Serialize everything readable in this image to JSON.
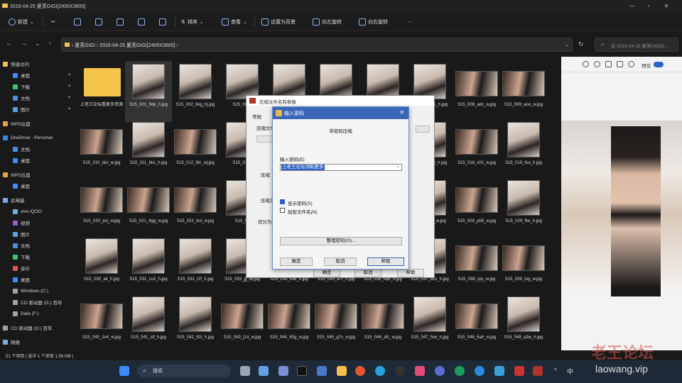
{
  "window": {
    "title": "2016-04-25 夏芙GIGI[2400X3600]"
  },
  "toolbar": {
    "new_label": "新建",
    "sort_label": "排序",
    "view_label": "查看",
    "set_wallpaper_label": "设置为背景",
    "rotate_right_label": "向左旋转",
    "rotate_left_label": "向右旋转",
    "more_label": "···"
  },
  "address": {
    "path_1": "夏芙GIGI",
    "path_2": "2016-04-25 夏芙GIGI[2400X3600]",
    "search_placeholder": "在 2016-04-25 夏芙GIGI[2..."
  },
  "sidebar": {
    "items": [
      {
        "label": "快速访问"
      },
      {
        "label": "桌面"
      },
      {
        "label": "下载"
      },
      {
        "label": "文档"
      },
      {
        "label": "图片"
      },
      {
        "label": "WPS云盘"
      },
      {
        "label": "OneDrive - Personal"
      },
      {
        "label": "文档"
      },
      {
        "label": "桌面"
      },
      {
        "label": "WPS云盘"
      },
      {
        "label": "桌面"
      },
      {
        "label": "此电脑"
      },
      {
        "label": "vivo iQOO"
      },
      {
        "label": "视频"
      },
      {
        "label": "图片"
      },
      {
        "label": "文档"
      },
      {
        "label": "下载"
      },
      {
        "label": "音乐"
      },
      {
        "label": "桌面"
      },
      {
        "label": "Windows (C:)"
      },
      {
        "label": "CD 驱动器 (G:) 百年"
      },
      {
        "label": "Data (F:)"
      },
      {
        "label": "CD 驱动器 (G:) 百年"
      },
      {
        "label": "网络"
      }
    ]
  },
  "files": [
    {
      "name": "上老王论坛看更多资源",
      "kind": "folder"
    },
    {
      "name": "S15_001_9dp_h.jpg"
    },
    {
      "name": "S15_002_6kg_hj.jpg"
    },
    {
      "name": "S15_003_"
    },
    {
      "name": ""
    },
    {
      "name": ""
    },
    {
      "name": ""
    },
    {
      "name": "S15_00_g1s_h.jpg"
    },
    {
      "name": "S15_008_adc_w.jpg",
      "wide": true
    },
    {
      "name": "S15_009_aoo_w.jpg",
      "wide": true
    },
    {
      "name": "S15_010_dur_w.jpg",
      "wide": true
    },
    {
      "name": "S15_011_bkc_h.jpg"
    },
    {
      "name": "S15_012_8lz_wj.jpg",
      "wide": true
    },
    {
      "name": "S15_013_"
    },
    {
      "name": ""
    },
    {
      "name": ""
    },
    {
      "name": ""
    },
    {
      "name": "S15_0_mx8_h.jpg"
    },
    {
      "name": "S15_018_x01_w.jpg",
      "wide": true
    },
    {
      "name": "S15_019_foa_h.jpg"
    },
    {
      "name": "S15_020_pxj_w.jpg",
      "wide": true
    },
    {
      "name": "S15_021_4gg_w.jpg",
      "wide": true
    },
    {
      "name": "S15_022_dul_w.jpg",
      "wide": true
    },
    {
      "name": "S15_02"
    },
    {
      "name": ""
    },
    {
      "name": ""
    },
    {
      "name": ""
    },
    {
      "name": "S15_0_fbc_w.jpg"
    },
    {
      "name": "S15_028_pb5_w.jpg",
      "wide": true
    },
    {
      "name": "S15_029_fke_h.jpg"
    },
    {
      "name": "S15_030_ait_h.jpg"
    },
    {
      "name": "S15_031_cu2_h.jpg"
    },
    {
      "name": "S15_032_r2f_h.jpg"
    },
    {
      "name": "S15_033_jjj_wj.jpg"
    },
    {
      "name": "S15_034_xu6_h.jpg"
    },
    {
      "name": "S15_035_a7r_h.jpg"
    },
    {
      "name": "S15_036_oq5_h.jpg"
    },
    {
      "name": "S15_037_b2s_h.jpg"
    },
    {
      "name": "S15_038_rpy_w.jpg",
      "wide": true
    },
    {
      "name": "S15_039_log_w.jpg",
      "wide": true
    },
    {
      "name": "S15_040_1v4_w.jpg",
      "wide": true
    },
    {
      "name": "S15_041_slf_h.jpg"
    },
    {
      "name": "S15_042_81t_h.jpg"
    },
    {
      "name": "S15_043_j14_w.jpg",
      "wide": true
    },
    {
      "name": "S15_044_45g_w.jpg",
      "wide": true
    },
    {
      "name": "S15_045_g7v_w.jpg",
      "wide": true
    },
    {
      "name": "S15_046_afc_w.jpg",
      "wide": true
    },
    {
      "name": "S15_047_fow_h.jpg"
    },
    {
      "name": "S15_048_6ah_w.jpg",
      "wide": true
    },
    {
      "name": "S15_049_a3w_h.jpg"
    }
  ],
  "preview": {
    "open_label": "预览"
  },
  "status": {
    "text": "51 个项目 | 选中 1 个项目 1.56 MB |"
  },
  "archive_dialog": {
    "title": "压缩文件名和参数",
    "tab_general": "常规",
    "label_name": "压缩文件",
    "label_format": "压缩",
    "label_method": "压缩方式",
    "label_split": "切分为",
    "ok": "确定",
    "cancel": "取消",
    "help": "帮助"
  },
  "password_dialog": {
    "title": "输入密码",
    "subtitle": "带密码压缩",
    "prompt": "输入密码(E)",
    "value": "上老王论坛领取更多",
    "show_password": "显示密码(S)",
    "encrypt_names": "加密文件名(N)",
    "organize": "整理密码(O)...",
    "ok": "确定",
    "cancel": "取消",
    "help": "帮助"
  },
  "taskbar": {
    "search_placeholder": "搜索",
    "lang": "中"
  },
  "watermark": {
    "line1": "老王论坛",
    "line2": "laowang.vip"
  }
}
